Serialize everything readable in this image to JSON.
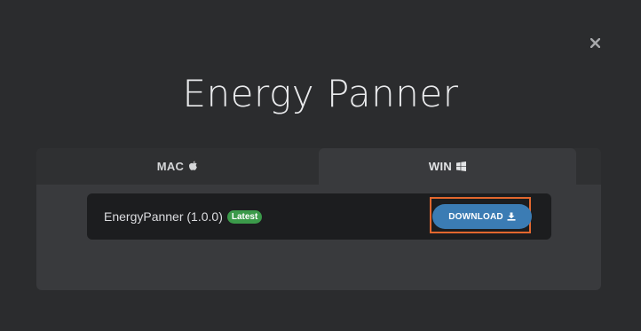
{
  "dialog": {
    "title": "Energy Panner",
    "close_icon": "close-icon"
  },
  "tabs": [
    {
      "label": "MAC",
      "icon": "apple-icon",
      "active": false
    },
    {
      "label": "WIN",
      "icon": "windows-icon",
      "active": true
    }
  ],
  "release": {
    "name": "EnergyPanner (1.0.0)",
    "badge": "Latest",
    "download_label": "DOWNLOAD",
    "download_icon": "download-icon"
  },
  "colors": {
    "background": "#2b2c2e",
    "panel": "#393a3d",
    "tab_bar": "#2f3032",
    "row": "#1c1d1f",
    "badge": "#3b9a4a",
    "download_button": "#3b7cb4",
    "highlight": "#e2672e"
  }
}
